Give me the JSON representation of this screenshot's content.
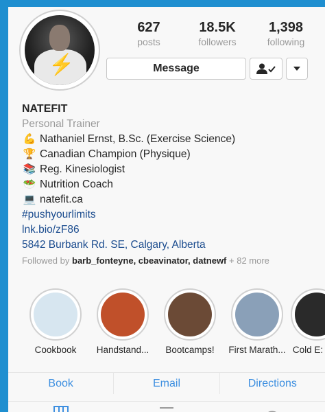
{
  "profile": {
    "stats": {
      "posts": {
        "value": "627",
        "label": "posts"
      },
      "followers": {
        "value": "18.5K",
        "label": "followers"
      },
      "following": {
        "value": "1,398",
        "label": "following"
      }
    },
    "buttons": {
      "message": "Message"
    },
    "name": "NATEFIT",
    "category": "Personal Trainer",
    "bio_lines": [
      {
        "icon": "flexed-biceps-icon",
        "text": "Nathaniel Ernst, B.Sc. (Exercise Science)"
      },
      {
        "icon": "trophy-icon",
        "text": "Canadian Champion (Physique)"
      },
      {
        "icon": "books-icon",
        "text": "Reg. Kinesiologist"
      },
      {
        "icon": "salad-icon",
        "text": "Nutrition Coach"
      },
      {
        "icon": "laptop-icon",
        "text": "natefit.ca"
      }
    ],
    "hashtag": "#pushyourlimits",
    "link": "lnk.bio/zF86",
    "address": "5842 Burbank Rd. SE, Calgary, Alberta",
    "followed_by": {
      "prefix": "Followed by",
      "users": "barb_fonteyne, cbeavinator, datnewf",
      "suffix": "+ 82 more"
    }
  },
  "highlights": [
    {
      "label": "Cookbook",
      "color": "#d7e6f0"
    },
    {
      "label": "Handstand...",
      "color": "#c0502a"
    },
    {
      "label": "Bootcamps!",
      "color": "#6b4a36"
    },
    {
      "label": "First Marath...",
      "color": "#8aa0b8"
    },
    {
      "label": "Cold E:",
      "color": "#2a2a2a"
    }
  ],
  "actions": [
    "Book",
    "Email",
    "Directions"
  ],
  "colors": {
    "background": "#1f8fd0",
    "link": "#1a4b8e",
    "action": "#3d8fe0"
  }
}
